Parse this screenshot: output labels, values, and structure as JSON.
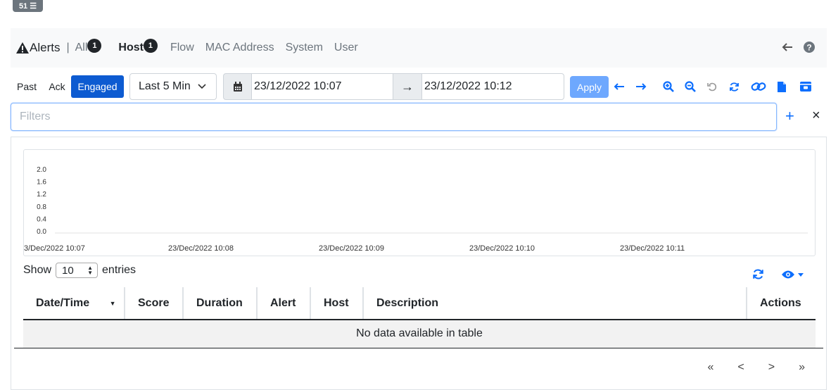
{
  "top_badge": {
    "count": "51",
    "icon": "list-icon"
  },
  "navbar": {
    "title": "Alerts",
    "separator": "|",
    "items": [
      {
        "label": "All",
        "badge": "1",
        "active": false
      },
      {
        "label": "Host",
        "badge": "1",
        "active": true
      },
      {
        "label": "Flow"
      },
      {
        "label": "MAC Address"
      },
      {
        "label": "System"
      },
      {
        "label": "User"
      }
    ]
  },
  "toolbar": {
    "past_label": "Past",
    "ack_label": "Ack",
    "engaged_label": "Engaged",
    "range_select": "Last 5 Min",
    "begin_date": "23/12/2022 10:07",
    "arrow": "→",
    "end_date": "23/12/2022 10:12",
    "apply_label": "Apply"
  },
  "filters": {
    "placeholder": "Filters",
    "add_glyph": "+",
    "clear_glyph": "×"
  },
  "chart_data": {
    "type": "line",
    "title": "",
    "xlabel": "",
    "ylabel": "",
    "y_ticks": [
      "2.0",
      "1.6",
      "1.2",
      "0.8",
      "0.4",
      "0.0"
    ],
    "x_ticks": [
      "3/Dec/2022 10:07",
      "23/Dec/2022 10:08",
      "23/Dec/2022 10:09",
      "23/Dec/2022 10:10",
      "23/Dec/2022 10:11"
    ],
    "ylim": [
      0,
      2.0
    ],
    "series": []
  },
  "table": {
    "show_label": "Show",
    "entries_label": "entries",
    "page_length": "10",
    "columns": [
      "Date/Time",
      "Score",
      "Duration",
      "Alert",
      "Host",
      "Description",
      "Actions"
    ],
    "empty_message": "No data available in table"
  },
  "pager": {
    "first": "«",
    "prev": "<",
    "next": ">",
    "last": "»"
  },
  "colors": {
    "accent": "#0d6efd",
    "engaged": "#0d5bd1",
    "apply": "#6ea8fe"
  }
}
